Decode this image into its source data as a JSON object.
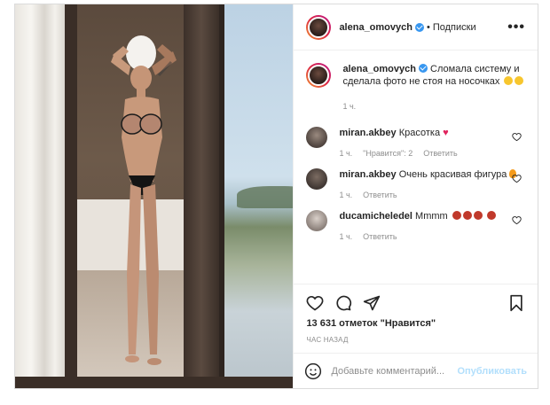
{
  "post": {
    "author": "alena_omovych",
    "follow_label": "Подписки",
    "dot": "•",
    "more": "•••",
    "caption": "Сломала систему и сделала фото не стоя на носочках",
    "caption_time": "1 ч."
  },
  "comments": [
    {
      "user": "miran.akbey",
      "text": "Красотка",
      "time": "1 ч.",
      "likes": "\"Нравится\": 2",
      "reply": "Ответить"
    },
    {
      "user": "miran.akbey",
      "text": "Очень красивая фигура",
      "time": "1 ч.",
      "reply": "Ответить"
    },
    {
      "user": "ducamicheledel",
      "text": "Mmmm",
      "time": "1 ч.",
      "reply": "Ответить"
    }
  ],
  "actions": {
    "likes_count": "13 631",
    "likes_text": "отметок \"Нравится\"",
    "timestamp": "час назад"
  },
  "composer": {
    "placeholder": "Добавьте комментарий...",
    "post_label": "Опубликовать"
  },
  "icons": [
    "heart-icon",
    "comment-icon",
    "share-icon",
    "bookmark-icon",
    "emoji-icon",
    "more-icon",
    "verified-icon"
  ],
  "colors": {
    "verified": "#3897f0",
    "link_disabled": "#b2dffc",
    "muted": "#8e8e8e",
    "text": "#262626"
  }
}
